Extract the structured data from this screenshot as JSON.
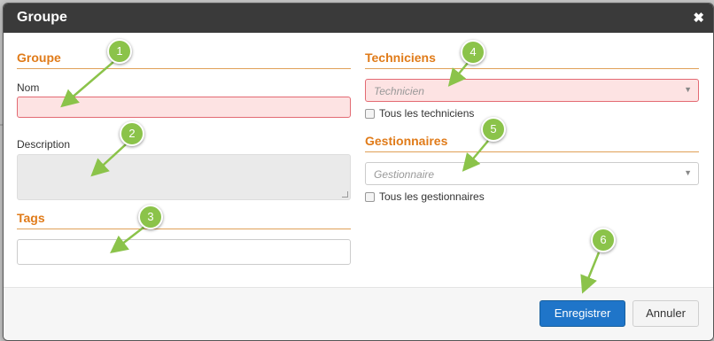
{
  "dialog": {
    "title": "Groupe",
    "close_glyph": "✖"
  },
  "left": {
    "groupe_section": "Groupe",
    "nom_label": "Nom",
    "nom_value": "",
    "description_label": "Description",
    "description_value": "",
    "tags_section": "Tags",
    "tags_value": ""
  },
  "right": {
    "techniciens_section": "Techniciens",
    "technicien_placeholder": "Technicien",
    "tous_techniciens_label": "Tous les techniciens",
    "gestionnaires_section": "Gestionnaires",
    "gestionnaire_placeholder": "Gestionnaire",
    "tous_gestionnaires_label": "Tous les gestionnaires"
  },
  "footer": {
    "save_label": "Enregistrer",
    "cancel_label": "Annuler"
  },
  "annotations": [
    "1",
    "2",
    "3",
    "4",
    "5",
    "6"
  ],
  "colors": {
    "accent": "#e07b19",
    "primary": "#1f75c9",
    "error_bg": "#fde3e3",
    "badge": "#8bc34a"
  },
  "icons": {
    "caret": "chevron-down-icon",
    "close": "close-icon"
  }
}
